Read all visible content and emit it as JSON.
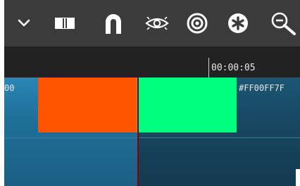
{
  "toolbar": {
    "icons": [
      "chevron-down-icon",
      "film-strip-icon",
      "magnet-icon",
      "eye-icon",
      "target-icon",
      "asterisk-icon",
      "zoom-out-icon"
    ]
  },
  "ruler": {
    "timecode": "00:00:05"
  },
  "track": {
    "clip_left_label": "00",
    "clip_right_label": "#FF00FF7F"
  },
  "colors": {
    "toolbar_bg": "#3b3b3b",
    "ruler_bg": "#222222",
    "clip_orange": "#ff5500",
    "clip_green": "#00ff7f",
    "playhead": "#8a0000"
  }
}
